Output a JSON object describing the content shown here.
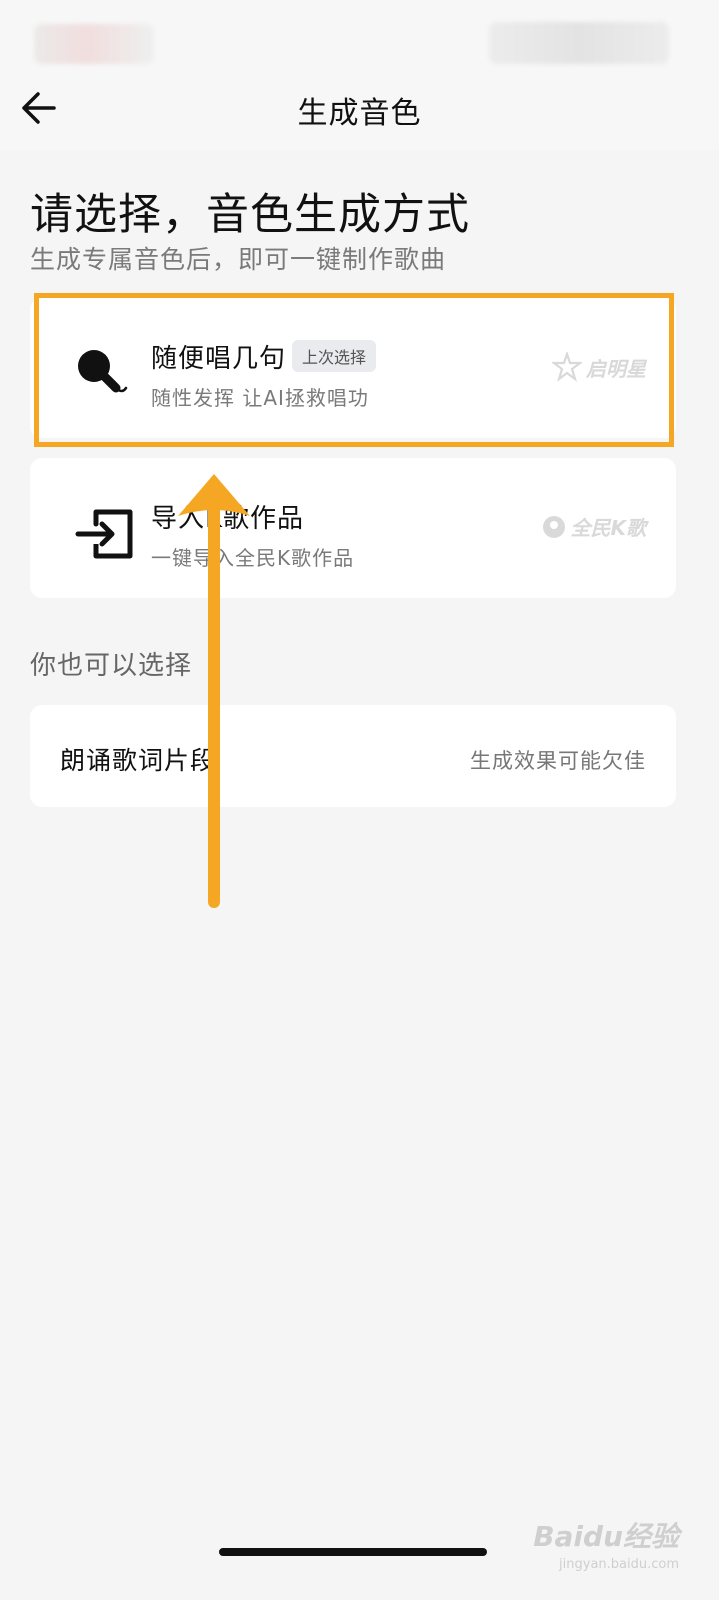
{
  "nav": {
    "title": "生成音色"
  },
  "header": {
    "heading": "请选择，音色生成方式",
    "subheading": "生成专属音色后，即可一键制作歌曲"
  },
  "cards": [
    {
      "title": "随便唱几句",
      "badge": "上次选择",
      "subtitle": "随性发挥 让AI拯救唱功",
      "brand": "启明星",
      "icon": "microphone-icon"
    },
    {
      "title": "导入K歌作品",
      "subtitle": "一键导入全民K歌作品",
      "brand": "全民K歌",
      "icon": "import-icon"
    }
  ],
  "section": {
    "label": "你也可以选择"
  },
  "option": {
    "title": "朗诵歌词片段",
    "note": "生成效果可能欠佳"
  },
  "watermark": {
    "main": "Baidu经验",
    "sub": "jingyan.baidu.com"
  },
  "colors": {
    "highlight": "#f5a623",
    "background": "#f5f5f5"
  }
}
